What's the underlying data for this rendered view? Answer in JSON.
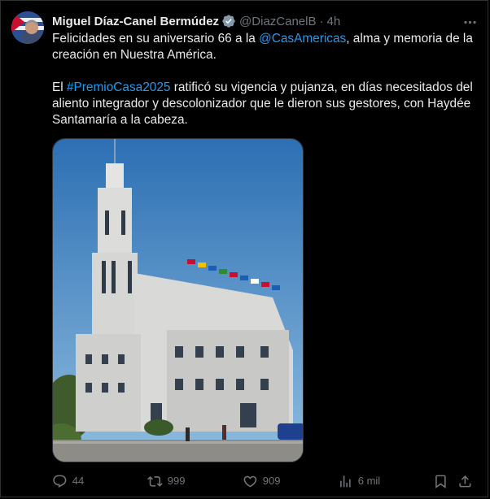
{
  "post": {
    "author_name": "Miguel Díaz-Canel Bermúdez",
    "handle": "@DiazCanelB",
    "separator": "·",
    "time": "4h",
    "text_p1_a": "Felicidades en su aniversario 66 a la ",
    "mention": "@CasAmericas",
    "text_p1_b": ", alma y memoria  de la creación en Nuestra América.",
    "text_p2_a": "El ",
    "hashtag": "#PremioCasa2025",
    "text_p2_b": " ratificó su vigencia y pujanza, en días necesitados del aliento integrador y descolonizador que le dieron sus gestores, con Haydée Santamaría a la cabeza."
  },
  "actions": {
    "replies": "44",
    "reposts": "999",
    "likes": "909",
    "views": "6 mil"
  },
  "icons": {
    "verified": "verified-badge-icon",
    "more": "more-icon",
    "reply": "reply-icon",
    "repost": "repost-icon",
    "like": "heart-icon",
    "views": "views-icon",
    "bookmark": "bookmark-icon",
    "share": "share-icon"
  },
  "colors": {
    "background": "#000000",
    "text": "#e7e9ea",
    "muted": "#71767b",
    "link": "#1d9bf0",
    "border": "#2f3336"
  }
}
